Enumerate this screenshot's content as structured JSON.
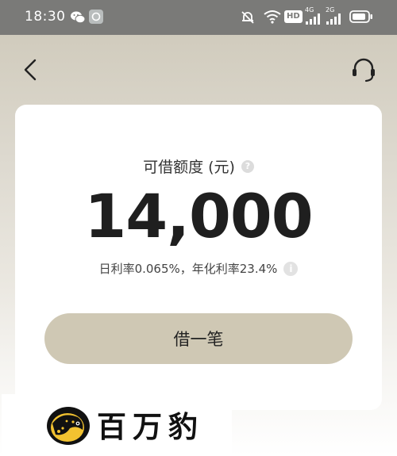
{
  "status_bar": {
    "time": "18:30",
    "hd_label": "HD",
    "network_4g": "4G",
    "network_2g": "2G"
  },
  "card": {
    "limit_label": "可借额度 (元)",
    "amount": "14,000",
    "rate_text": "日利率0.065%，年化利率23.4%",
    "help_glyph": "?",
    "info_glyph": "i",
    "borrow_button_label": "借一笔"
  },
  "watermark": {
    "text": "百万豹"
  },
  "colors": {
    "status_bar_bg": "#7a7a78",
    "button_bg": "#cfc8b4",
    "amount_color": "#1f1f1f"
  },
  "icons": {
    "back": "chevron-left-icon",
    "support": "headset-icon"
  }
}
